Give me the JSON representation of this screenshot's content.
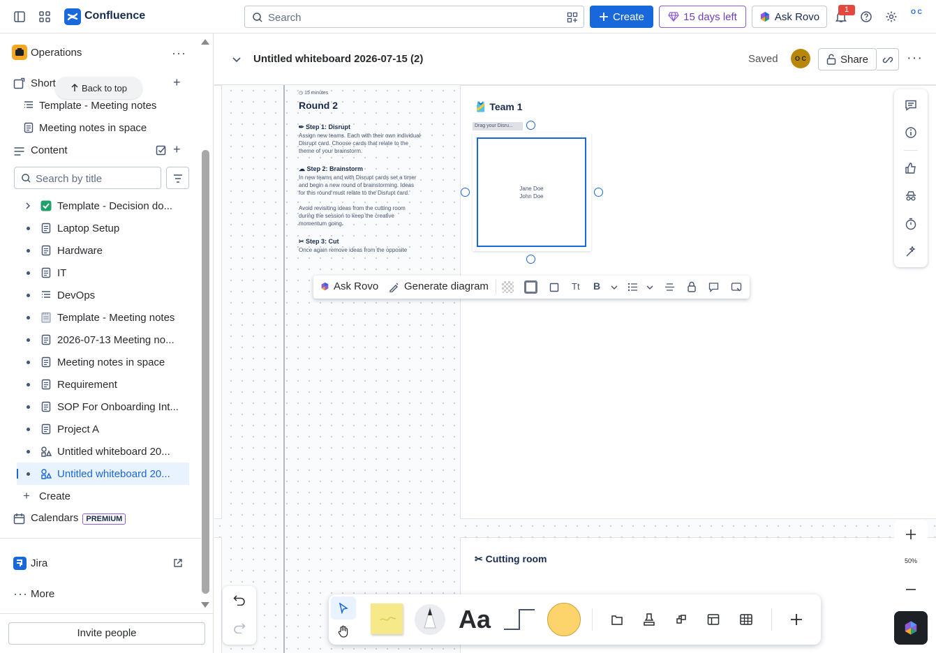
{
  "topnav": {
    "brand": "Confluence",
    "search_placeholder": "Search",
    "create_label": "Create",
    "trial_label": "15 days left",
    "rovo_label": "Ask Rovo",
    "notification_count": "1",
    "avatar_initials": "O C"
  },
  "sidebar": {
    "space_name": "Operations",
    "shortcuts_label": "Short",
    "back_to_top": "Back to top",
    "shortcut_items": [
      "Template - Meeting notes",
      "Meeting notes in space"
    ],
    "content_label": "Content",
    "search_placeholder": "Search by title",
    "tree": [
      {
        "label": "Template - Decision do...",
        "icon": "check-emoji-icon"
      },
      {
        "label": "Laptop Setup",
        "icon": "page-icon"
      },
      {
        "label": "Hardware",
        "icon": "page-icon"
      },
      {
        "label": "IT",
        "icon": "page-icon"
      },
      {
        "label": "DevOps",
        "icon": "live-doc-icon"
      },
      {
        "label": "Template - Meeting notes",
        "icon": "notepad-emoji-icon"
      },
      {
        "label": "2026-07-13 Meeting no...",
        "icon": "page-icon"
      },
      {
        "label": "Meeting notes in space",
        "icon": "page-icon"
      },
      {
        "label": "Requirement",
        "icon": "page-icon"
      },
      {
        "label": "SOP For Onboarding Int...",
        "icon": "page-icon"
      },
      {
        "label": "Project A",
        "icon": "page-icon"
      },
      {
        "label": "Untitled whiteboard 20...",
        "icon": "whiteboard-icon"
      },
      {
        "label": "Untitled whiteboard 20...",
        "icon": "whiteboard-icon",
        "selected": true
      }
    ],
    "create_label": "Create",
    "calendars_label": "Calendars",
    "premium_badge": "PREMIUM",
    "jira_label": "Jira",
    "more_label": "More",
    "invite_label": "Invite people"
  },
  "page": {
    "title": "Untitled whiteboard 2026-07-15 (2)",
    "status": "Saved",
    "collab_initials": "O C",
    "share_label": "Share"
  },
  "board": {
    "round_timer": "15 minutes",
    "round_title": "Round 2",
    "step1_title": "Step 1: Disrupt",
    "step1_text": "Assign new teams. Each with their own individual Disrupt card. Choose cards that relate to the theme of your brainstorm.",
    "step2_title": "Step 2: Brainstorm",
    "step2_text": "In new teams and with Disrupt cards set a timer and begin a new round of brainstorming. Ideas for this round must relate to the Disrupt card.",
    "step2_text2": "Avoid revisiting ideas from the cutting room during the session to keep the creative momentum going.",
    "step3_title": "Step 3: Cut",
    "step3_text": "Once again remove ideas from the opposite teams list",
    "team_title": "Team 1",
    "drag_label": "Drag your Disru...",
    "sticky_line1": "Jane Doe",
    "sticky_line2": "John Doe",
    "cutting_title": "Cutting room",
    "zoom_level": "50%"
  },
  "context_toolbar": {
    "ask_rovo": "Ask Rovo",
    "generate_diagram": "Generate diagram"
  },
  "colors": {
    "accent": "#1868db",
    "sticky_yellow": "#f5e989",
    "shape_orange": "#fcd46b",
    "trial_purple": "#8f5ad6"
  }
}
